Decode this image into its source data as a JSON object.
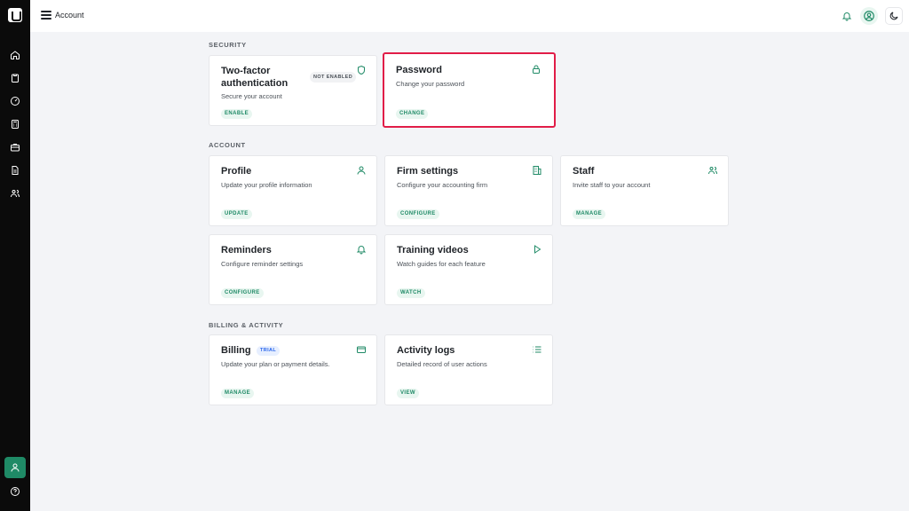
{
  "app": {
    "page_title": "Account"
  },
  "sections": {
    "security": "SECURITY",
    "account": "ACCOUNT",
    "billing": "BILLING & ACTIVITY"
  },
  "cards": {
    "two_factor": {
      "title": "Two-factor authentication",
      "subtitle": "Secure your account",
      "badge": "NOT ENABLED",
      "action": "ENABLE",
      "icon": "shield-icon"
    },
    "password": {
      "title": "Password",
      "subtitle": "Change your password",
      "action": "CHANGE",
      "icon": "lock-icon"
    },
    "profile": {
      "title": "Profile",
      "subtitle": "Update your profile information",
      "action": "UPDATE",
      "icon": "user-icon"
    },
    "firm_settings": {
      "title": "Firm settings",
      "subtitle": "Configure your accounting firm",
      "action": "CONFIGURE",
      "icon": "building-icon"
    },
    "staff": {
      "title": "Staff",
      "subtitle": "Invite staff to your account",
      "action": "MANAGE",
      "icon": "users-icon"
    },
    "reminders": {
      "title": "Reminders",
      "subtitle": "Configure reminder settings",
      "action": "CONFIGURE",
      "icon": "bell-icon"
    },
    "training": {
      "title": "Training videos",
      "subtitle": "Watch guides for each feature",
      "action": "WATCH",
      "icon": "play-icon"
    },
    "billing": {
      "title": "Billing",
      "subtitle": "Update your plan or payment details.",
      "badge": "TRIAL",
      "action": "MANAGE",
      "icon": "credit-card-icon"
    },
    "activity": {
      "title": "Activity logs",
      "subtitle": "Detailed record of user actions",
      "action": "VIEW",
      "icon": "list-icon"
    }
  },
  "colors": {
    "accent": "#1f8a66",
    "highlight_border": "#e11d48",
    "rail": "#0b0b0b",
    "background": "#f3f4f7"
  }
}
